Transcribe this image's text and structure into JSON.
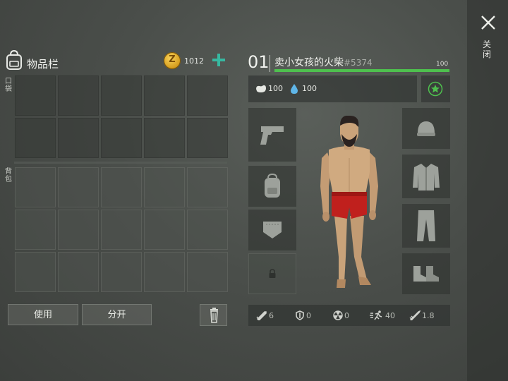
{
  "inventory": {
    "title": "物品栏",
    "coin_symbol": "Z",
    "coins": "1012",
    "pocket_label": "口袋",
    "bag_label": "背包",
    "pocket_slots": 10,
    "bag_slots": 15
  },
  "actions": {
    "use_label": "使用",
    "split_label": "分开"
  },
  "character": {
    "level": "01",
    "name": "卖小女孩的火柴",
    "tag": "#5374",
    "xp_value": "100",
    "xp_fraction": 1.0,
    "food": "100",
    "water": "100"
  },
  "equipment": {
    "left": [
      "pistol-icon",
      "backpack-icon",
      "pocket-icon",
      "lock-icon"
    ],
    "right": [
      "hat-icon",
      "jacket-icon",
      "pants-icon",
      "boots-icon"
    ]
  },
  "bottom_stats": {
    "attack": "6",
    "defense": "0",
    "radiation": "0",
    "speed": "40",
    "weight": "1.8"
  },
  "close": {
    "label": "关闭"
  },
  "colors": {
    "accent": "#4ec04e",
    "plus": "#37b8a0",
    "coin": "#e0a82a"
  }
}
